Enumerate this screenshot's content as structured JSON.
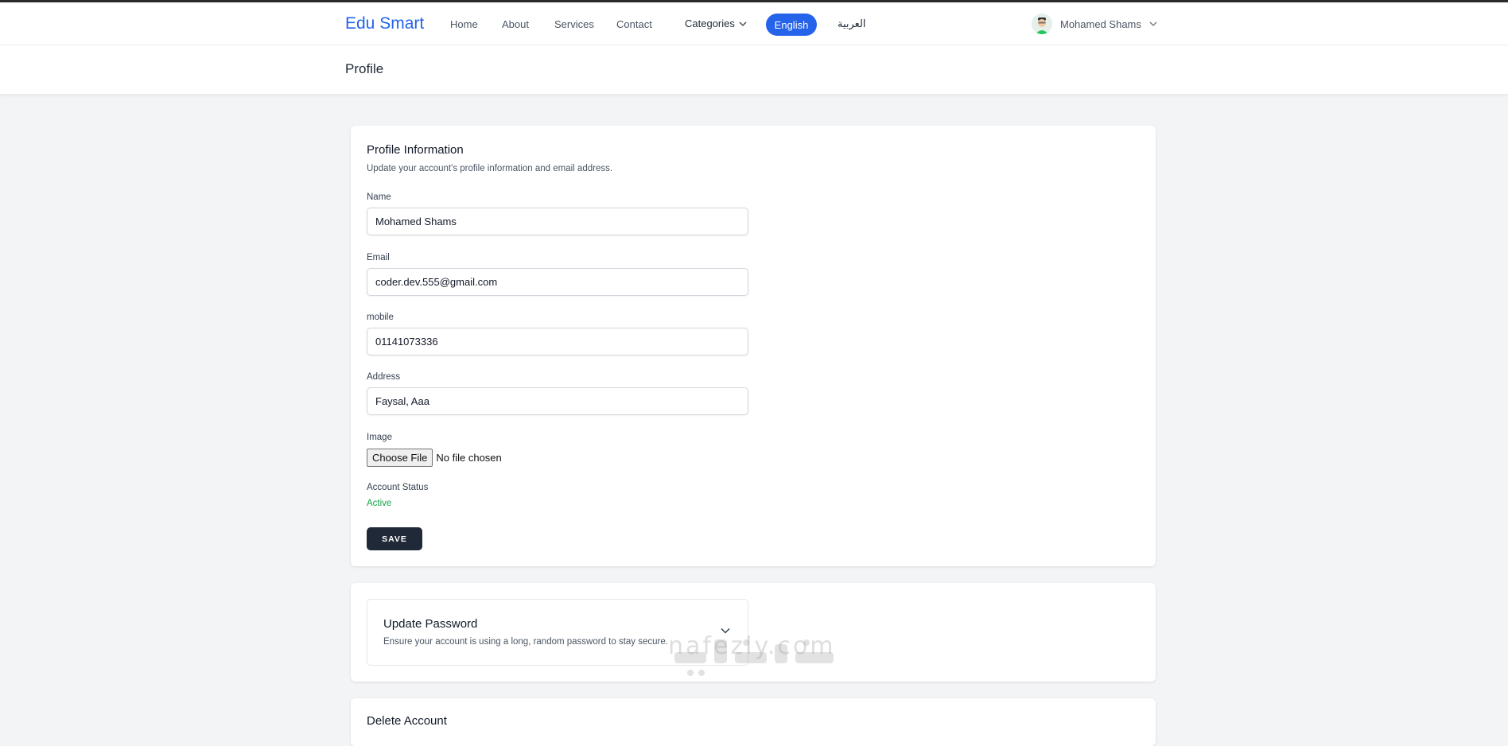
{
  "nav": {
    "brand": "Edu Smart",
    "links": [
      "Home",
      "About",
      "Services",
      "Contact"
    ],
    "categories_label": "Categories",
    "lang_en": "English",
    "lang_ar": "العربية",
    "user_name": "Mohamed Shams"
  },
  "header": {
    "title": "Profile"
  },
  "profile": {
    "title": "Profile Information",
    "description": "Update your account's profile information and email address.",
    "name_label": "Name",
    "name_value": "Mohamed Shams",
    "email_label": "Email",
    "email_value": "coder.dev.555@gmail.com",
    "mobile_label": "mobile",
    "mobile_value": "01141073336",
    "address_label": "Address",
    "address_value": "Faysal, Aaa",
    "image_label": "Image",
    "file_button": "Choose File",
    "file_status": "No file chosen",
    "status_label": "Account Status",
    "status_value": "Active",
    "save_label": "SAVE"
  },
  "password": {
    "title": "Update Password",
    "description": "Ensure your account is using a long, random password to stay secure."
  },
  "delete": {
    "title": "Delete Account"
  },
  "watermark": {
    "text": "nafezly.com"
  },
  "colors": {
    "primary": "#2563eb",
    "dark": "#1f2937",
    "success": "#16a34a",
    "background": "#f3f4f6"
  }
}
